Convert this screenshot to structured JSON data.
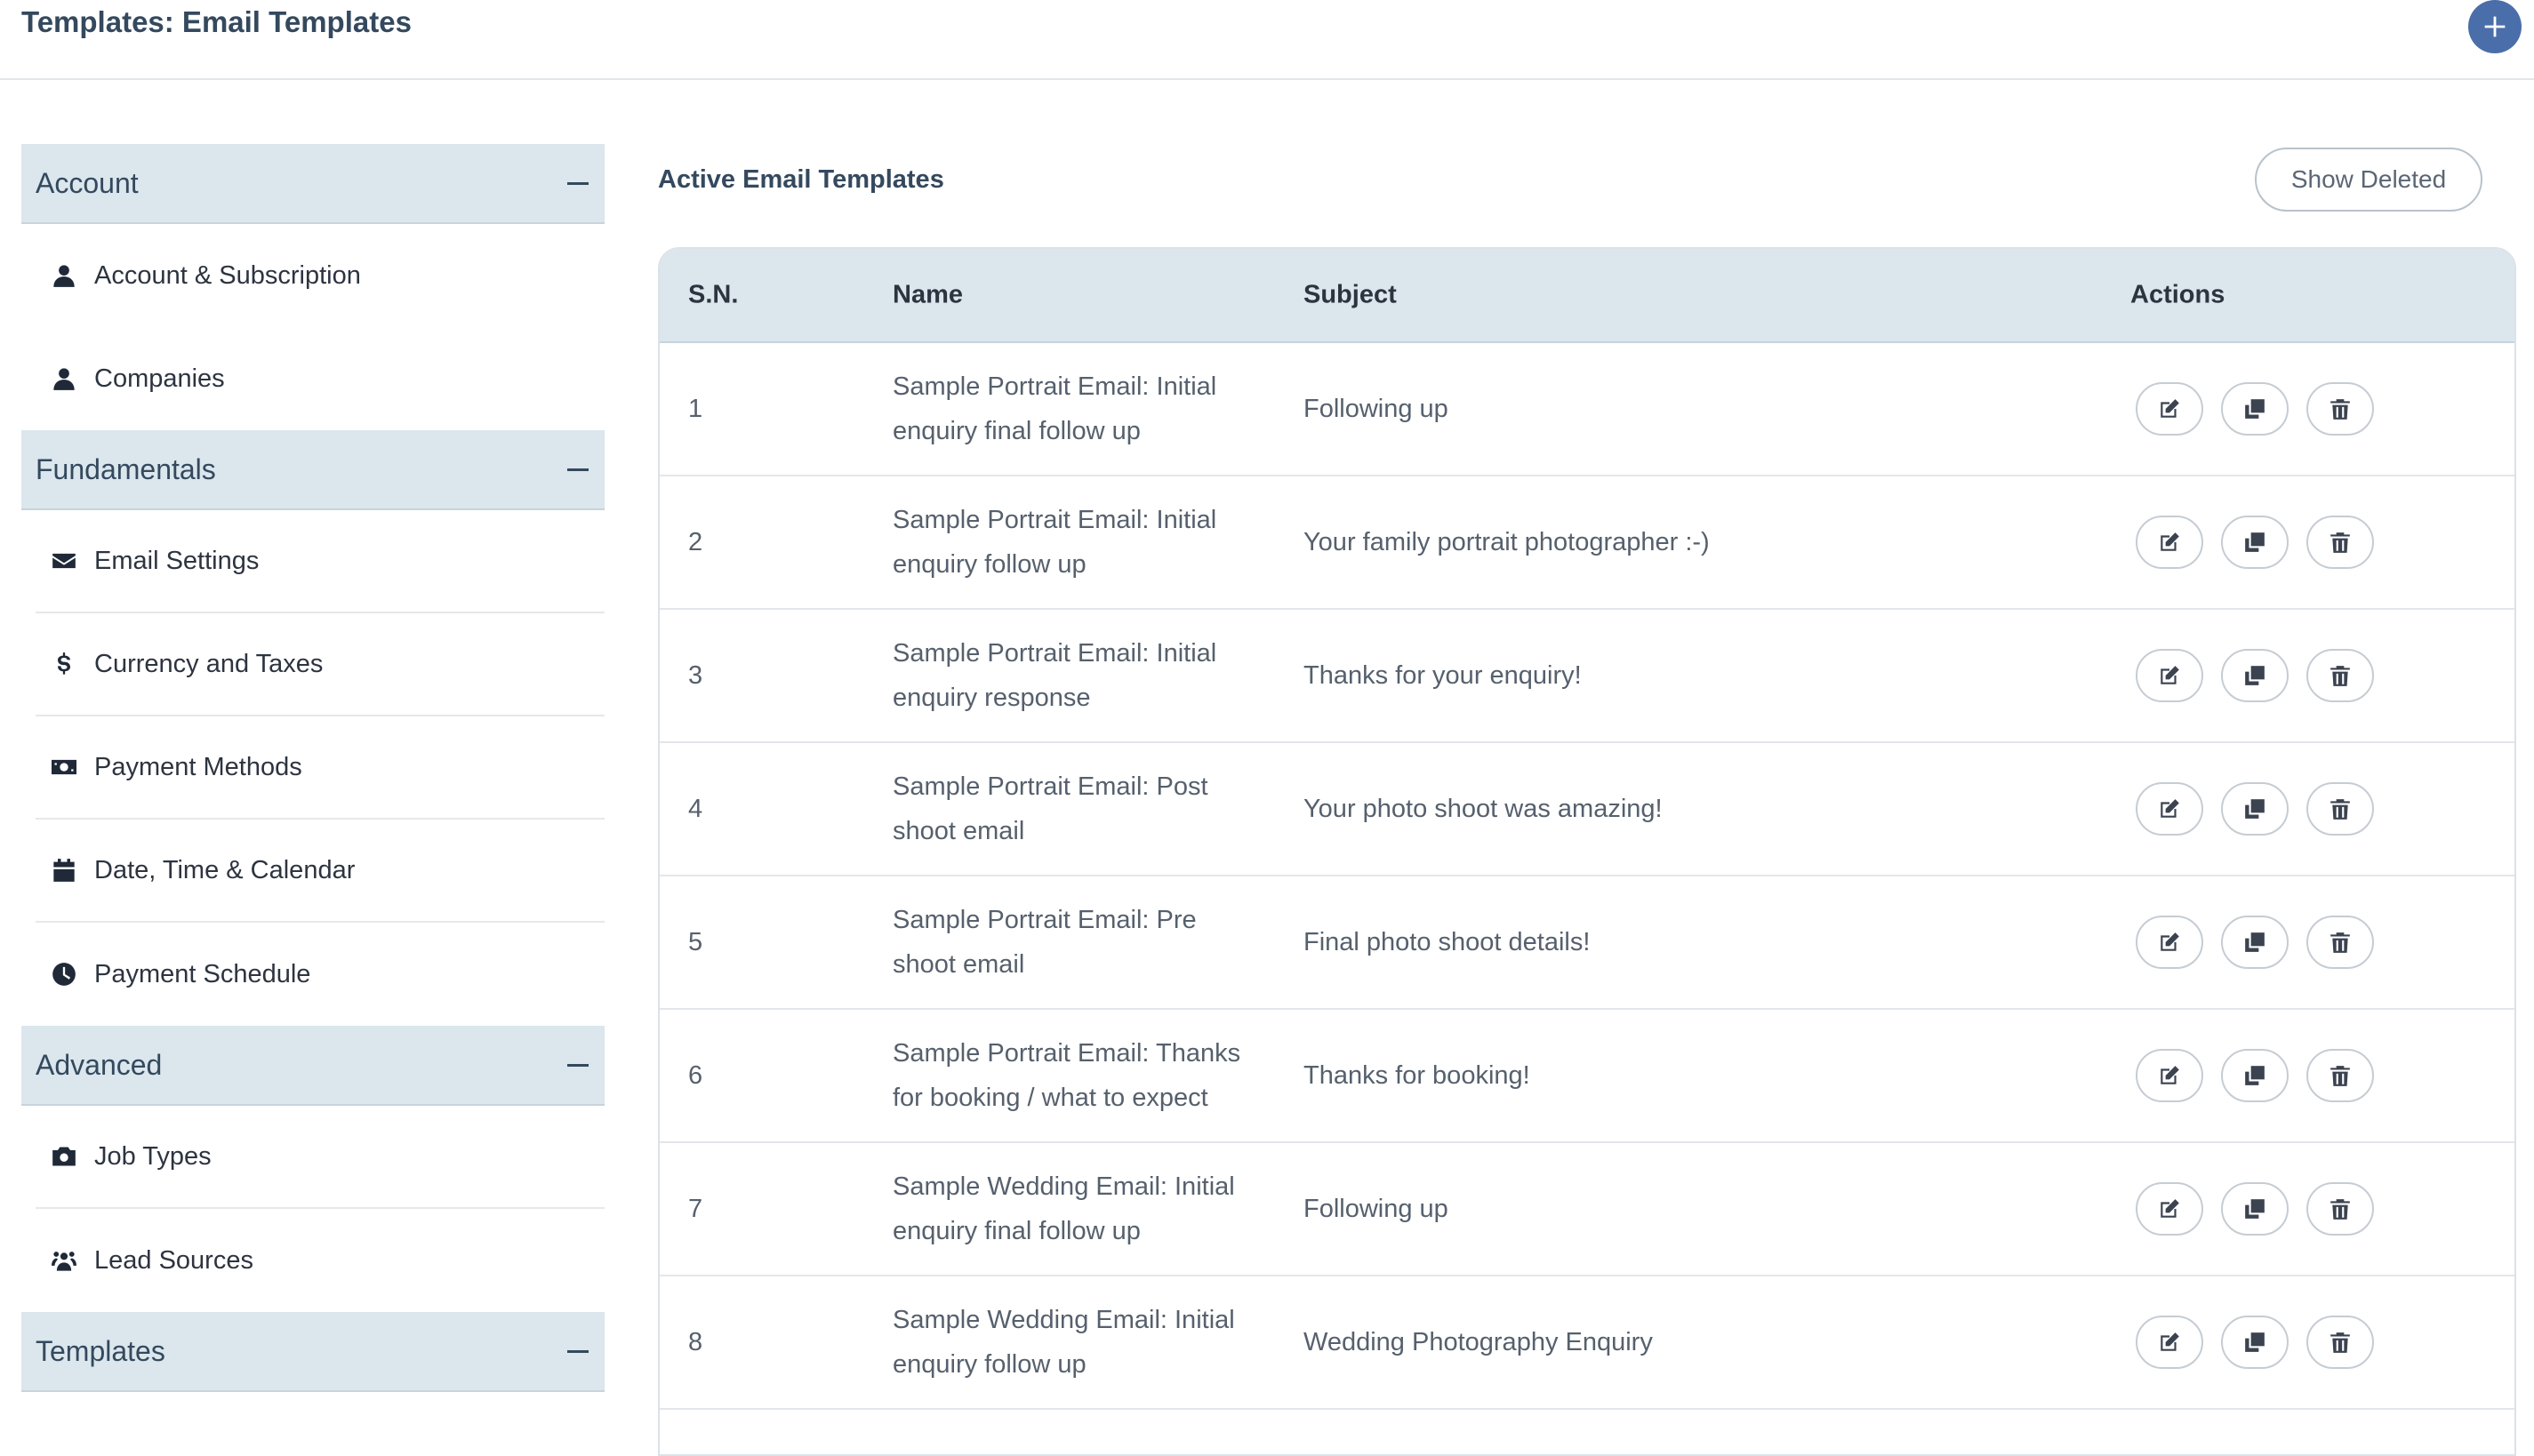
{
  "page_title": "Templates: Email Templates",
  "sidebar": {
    "sections": [
      {
        "title": "Account",
        "items": [
          {
            "label": "Account & Subscription",
            "icon": "user-icon"
          },
          {
            "label": "Companies",
            "icon": "user-icon"
          }
        ]
      },
      {
        "title": "Fundamentals",
        "items": [
          {
            "label": "Email Settings",
            "icon": "envelope-icon"
          },
          {
            "label": "Currency and Taxes",
            "icon": "dollar-icon"
          },
          {
            "label": "Payment Methods",
            "icon": "money-bill-icon"
          },
          {
            "label": "Date, Time & Calendar",
            "icon": "calendar-icon"
          },
          {
            "label": "Payment Schedule",
            "icon": "clock-icon"
          }
        ]
      },
      {
        "title": "Advanced",
        "items": [
          {
            "label": "Job Types",
            "icon": "camera-icon"
          },
          {
            "label": "Lead Sources",
            "icon": "people-icon"
          }
        ]
      },
      {
        "title": "Templates",
        "items": []
      }
    ]
  },
  "main": {
    "heading": "Active Email Templates",
    "show_deleted_label": "Show Deleted",
    "table": {
      "headers": {
        "sn": "S.N.",
        "name": "Name",
        "subject": "Subject",
        "actions": "Actions"
      },
      "rows": [
        {
          "sn": "1",
          "name": "Sample Portrait Email: Initial enquiry final follow up",
          "subject": "Following up"
        },
        {
          "sn": "2",
          "name": "Sample Portrait Email: Initial enquiry follow up",
          "subject": "Your family portrait photographer :-)"
        },
        {
          "sn": "3",
          "name": "Sample Portrait Email: Initial enquiry response",
          "subject": "Thanks for your enquiry!"
        },
        {
          "sn": "4",
          "name": "Sample Portrait Email: Post shoot email",
          "subject": "Your photo shoot was amazing!"
        },
        {
          "sn": "5",
          "name": "Sample Portrait Email: Pre shoot email",
          "subject": "Final photo shoot details!"
        },
        {
          "sn": "6",
          "name": "Sample Portrait Email: Thanks for booking / what to expect",
          "subject": "Thanks for booking!"
        },
        {
          "sn": "7",
          "name": "Sample Wedding Email: Initial enquiry final follow up",
          "subject": "Following up"
        },
        {
          "sn": "8",
          "name": "Sample Wedding Email: Initial enquiry follow up",
          "subject": "Wedding Photography Enquiry"
        }
      ]
    }
  },
  "colors": {
    "accent": "#4a6ea9",
    "section_header_bg": "#dbe6ed"
  }
}
